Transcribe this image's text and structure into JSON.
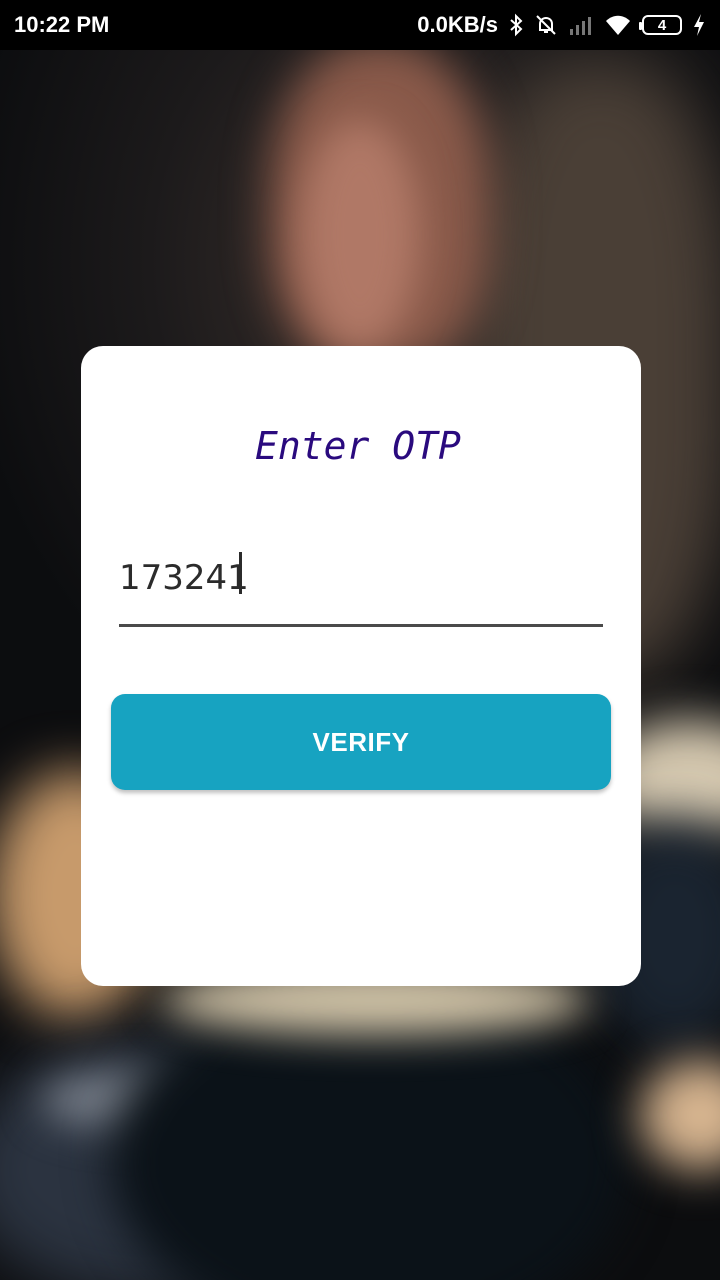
{
  "status_bar": {
    "time": "10:22 PM",
    "network_speed": "0.0KB/s",
    "battery_level": "4",
    "icons": [
      "bluetooth-icon",
      "mute-bell-icon",
      "signal-icon",
      "wifi-icon",
      "battery-icon",
      "charging-bolt-icon"
    ]
  },
  "otp_card": {
    "title": "Enter OTP",
    "otp_value": "173241",
    "verify_label": "VERIFY"
  },
  "colors": {
    "title": "#2a0a7e",
    "button": "#17a3c1",
    "button_text": "#ffffff",
    "card": "#ffffff"
  }
}
